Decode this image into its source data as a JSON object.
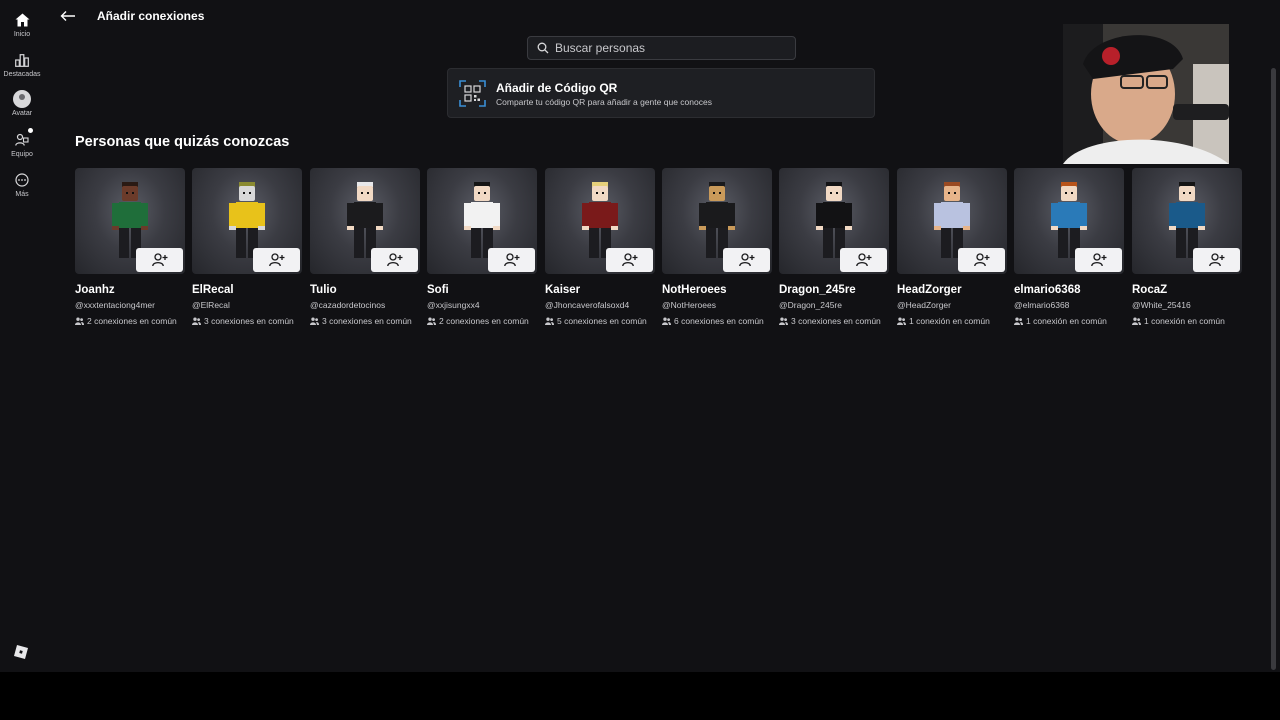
{
  "sidebar": {
    "items": [
      {
        "label": "Inicio",
        "icon": "home-icon"
      },
      {
        "label": "Destacadas",
        "icon": "charts-icon"
      },
      {
        "label": "Avatar",
        "icon": "avatar-icon"
      },
      {
        "label": "Equipo",
        "icon": "team-icon"
      },
      {
        "label": "Más",
        "icon": "more-icon"
      }
    ]
  },
  "header": {
    "title": "Añadir conexiones",
    "back_icon": "arrow-left-icon"
  },
  "search": {
    "placeholder": "Buscar personas",
    "icon": "search-icon"
  },
  "qr": {
    "title": "Añadir de Código QR",
    "subtitle": "Comparte tu código QR para añadir a gente que conoces",
    "icon": "qr-code-icon"
  },
  "section": {
    "title": "Personas que quizás conozcas"
  },
  "people": [
    {
      "name": "Joanhz",
      "handle": "@xxxtentaciong4mer",
      "mutual": "2 conexiones en común",
      "body": "#1f6e3a",
      "head": "#6b3b2a",
      "hair": "#2a1a14"
    },
    {
      "name": "ElRecal",
      "handle": "@ElRecal",
      "mutual": "3 conexiones en común",
      "body": "#e8c21a",
      "head": "#d8d8d8",
      "hair": "#8a8a30"
    },
    {
      "name": "Tulio",
      "handle": "@cazadordetocinos",
      "mutual": "3 conexiones en común",
      "body": "#1b1b1d",
      "head": "#f1d9c4",
      "hair": "#e8e8ea"
    },
    {
      "name": "Sofi",
      "handle": "@xxjisungxx4",
      "mutual": "2 conexiones en común",
      "body": "#f2f2f2",
      "head": "#f1d9c4",
      "hair": "#141414"
    },
    {
      "name": "Kaiser",
      "handle": "@Jhoncaverofalsoxd4",
      "mutual": "5 conexiones en común",
      "body": "#7a1a1a",
      "head": "#f1d9c4",
      "hair": "#e6d07a"
    },
    {
      "name": "NotHeroees",
      "handle": "@NotHeroees",
      "mutual": "6 conexiones en común",
      "body": "#1a1a1c",
      "head": "#c99a5a",
      "hair": "#1a1a1c"
    },
    {
      "name": "Dragon_245re",
      "handle": "@Dragon_245re",
      "mutual": "3 conexiones en común",
      "body": "#121214",
      "head": "#f1d9c4",
      "hair": "#121214"
    },
    {
      "name": "HeadZorger",
      "handle": "@HeadZorger",
      "mutual": "1 conexión en común",
      "body": "#b9c2e0",
      "head": "#e7b48a",
      "hair": "#9a4a22"
    },
    {
      "name": "elmario6368",
      "handle": "@elmario6368",
      "mutual": "1 conexión en común",
      "body": "#2a7ab8",
      "head": "#f1d9c4",
      "hair": "#b8541a"
    },
    {
      "name": "RocaZ",
      "handle": "@White_25416",
      "mutual": "1 conexión en común",
      "body": "#1a5a8a",
      "head": "#f1d9c4",
      "hair": "#141414"
    }
  ],
  "icons": {
    "add_friend": "add-friend-icon",
    "mutual": "people-icon",
    "logo": "roblox-logo-icon"
  },
  "colors": {
    "background": "#111114",
    "card": "#1e1f23",
    "qr_accent": "#3a8fd6"
  }
}
